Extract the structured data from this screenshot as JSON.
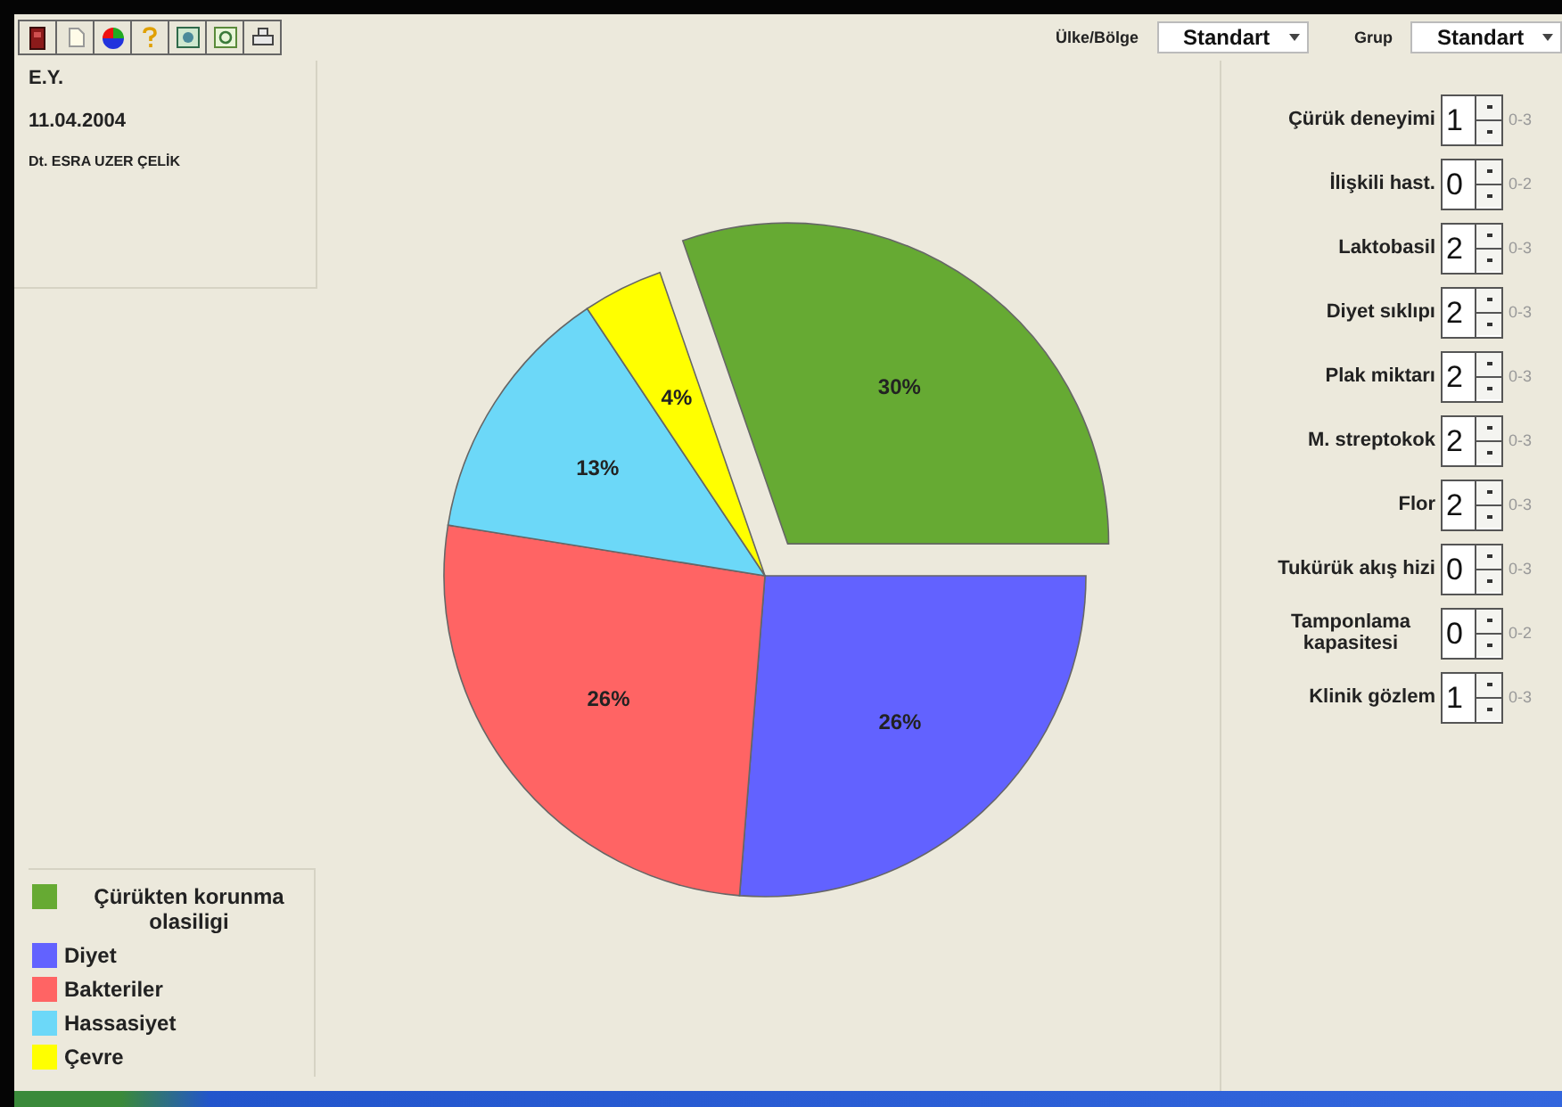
{
  "toolbar": [
    {
      "kind": "exit"
    },
    {
      "kind": "page"
    },
    {
      "kind": "pie"
    },
    {
      "kind": "help"
    },
    {
      "kind": "image"
    },
    {
      "kind": "refresh"
    },
    {
      "kind": "print"
    }
  ],
  "filters": [
    {
      "label": "Ülke/Bölge",
      "value": "Standart"
    },
    {
      "label": "Grup",
      "value": "Standart"
    }
  ],
  "patient": {
    "initials": "E.Y.",
    "date": "11.04.2004",
    "dentist": "Dt. ESRA UZER ÇELİK"
  },
  "chart": {
    "chart_data": {
      "type": "pie",
      "categories": [
        "Çürükten korunma olasiligi",
        "Diyet",
        "Bakteriler",
        "Hassasiyet",
        "Çevre"
      ],
      "values": [
        30,
        26,
        26,
        13,
        4
      ],
      "data_labels": true,
      "value_labels": [
        "30%",
        "26%",
        "26%",
        "13%",
        "4%"
      ]
    },
    "legend": [
      {
        "color": "#66aa33"
      },
      {
        "color": "#6262ff"
      },
      {
        "color": "#ff6464"
      },
      {
        "color": "#6cd8f8"
      },
      {
        "color": "#ffff00"
      }
    ]
  },
  "factors": [
    {
      "label": "Çürük deneyimi",
      "value": "1",
      "range": "0-3"
    },
    {
      "label": "İlişkili hast.",
      "value": "0",
      "range": "0-2"
    },
    {
      "label": "Laktobasil",
      "value": "2",
      "range": "0-3"
    },
    {
      "label": "Diyet sıklıpı",
      "value": "2",
      "range": "0-3"
    },
    {
      "label": "Plak miktarı",
      "value": "2",
      "range": "0-3"
    },
    {
      "label": "M. streptokok",
      "value": "2",
      "range": "0-3"
    },
    {
      "label": "Flor",
      "value": "2",
      "range": "0-3"
    },
    {
      "label": "Tukürük akış hizi",
      "value": "0",
      "range": "0-3"
    },
    {
      "label": "Tamponlama kapasitesi",
      "value": "0",
      "range": "0-2"
    },
    {
      "label": "Klinik gözlem",
      "value": "1",
      "range": "0-3"
    }
  ]
}
